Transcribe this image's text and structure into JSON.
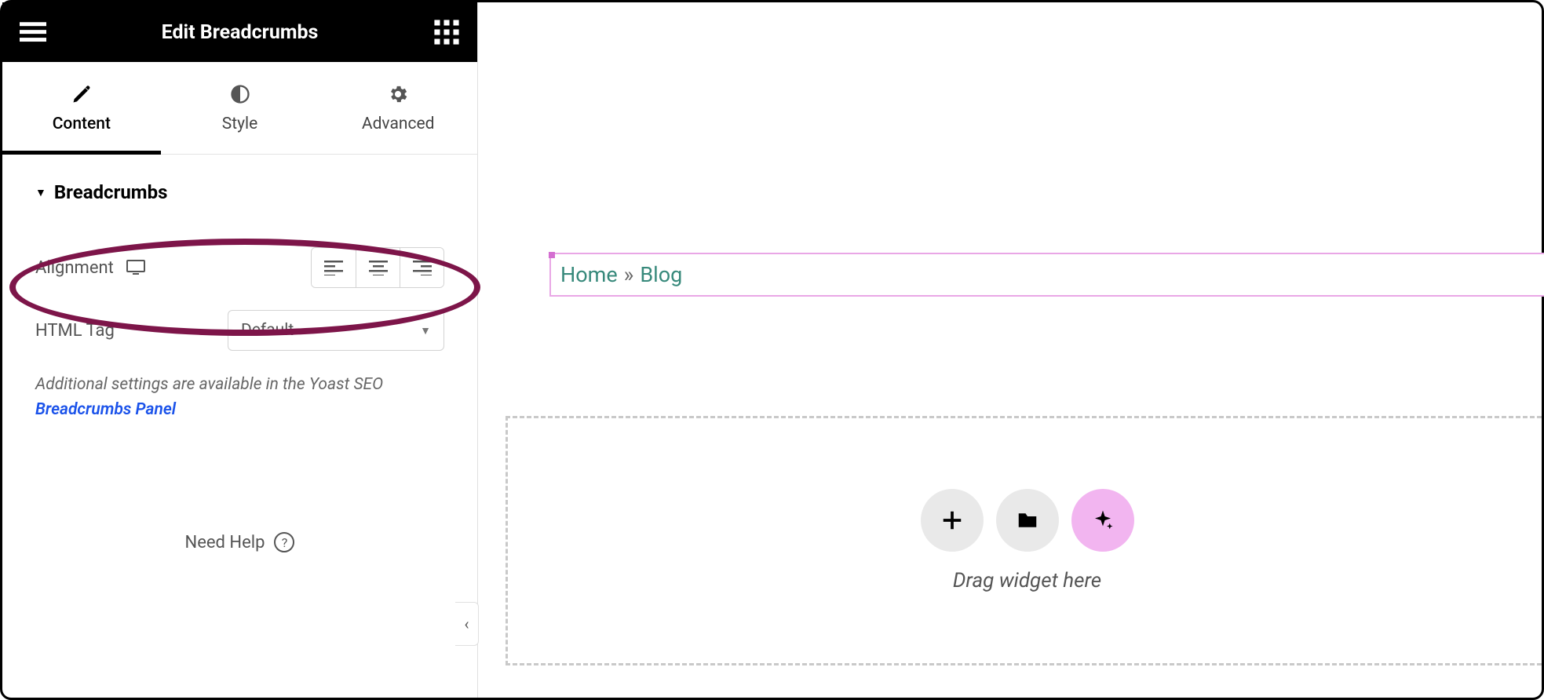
{
  "header": {
    "title": "Edit Breadcrumbs"
  },
  "tabs": [
    {
      "id": "content",
      "label": "Content",
      "icon": "pencil",
      "active": true
    },
    {
      "id": "style",
      "label": "Style",
      "icon": "contrast",
      "active": false
    },
    {
      "id": "advanced",
      "label": "Advanced",
      "icon": "gear",
      "active": false
    }
  ],
  "section": {
    "title": "Breadcrumbs"
  },
  "controls": {
    "alignment": {
      "label": "Alignment",
      "device_icon": "desktop",
      "options": [
        "left",
        "center",
        "right"
      ]
    },
    "html_tag": {
      "label": "HTML Tag",
      "value": "Default"
    },
    "note_prefix": "Additional settings are available in the Yoast SEO ",
    "note_link": "Breadcrumbs Panel"
  },
  "help": {
    "label": "Need Help"
  },
  "collapse_handle": {
    "glyph": "‹"
  },
  "canvas": {
    "breadcrumb": {
      "items": [
        "Home",
        "Blog"
      ],
      "separator": "»"
    },
    "dropzone": {
      "label": "Drag widget here",
      "actions": [
        {
          "id": "add",
          "icon": "plus"
        },
        {
          "id": "folder",
          "icon": "folder"
        },
        {
          "id": "ai",
          "icon": "sparkle"
        }
      ]
    }
  }
}
